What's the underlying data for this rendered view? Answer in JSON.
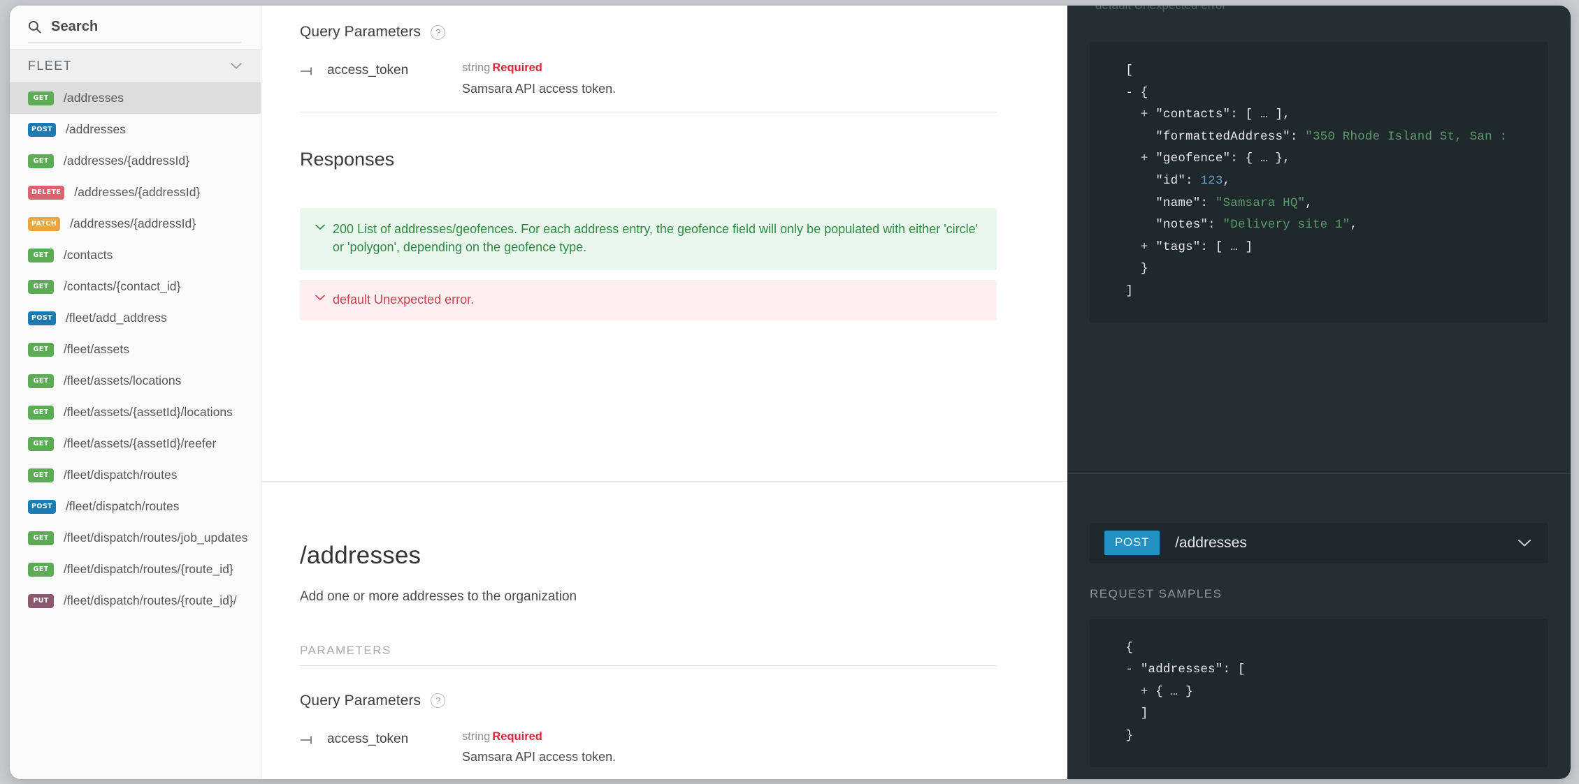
{
  "sidebar": {
    "search": {
      "placeholder": "Search",
      "icon": "search-icon"
    },
    "group": {
      "label": "FLEET",
      "icon": "chevron-down-icon"
    },
    "items": [
      {
        "method": "GET",
        "path": "/addresses",
        "active": true
      },
      {
        "method": "POST",
        "path": "/addresses",
        "active": false
      },
      {
        "method": "GET",
        "path": "/addresses/{addressId}",
        "active": false
      },
      {
        "method": "DELETE",
        "path": "/addresses/{addressId}",
        "active": false
      },
      {
        "method": "PATCH",
        "path": "/addresses/{addressId}",
        "active": false
      },
      {
        "method": "GET",
        "path": "/contacts",
        "active": false
      },
      {
        "method": "GET",
        "path": "/contacts/{contact_id}",
        "active": false
      },
      {
        "method": "POST",
        "path": "/fleet/add_address",
        "active": false
      },
      {
        "method": "GET",
        "path": "/fleet/assets",
        "active": false
      },
      {
        "method": "GET",
        "path": "/fleet/assets/locations",
        "active": false
      },
      {
        "method": "GET",
        "path": "/fleet/assets/{assetId}/locations",
        "active": false
      },
      {
        "method": "GET",
        "path": "/fleet/assets/{assetId}/reefer",
        "active": false
      },
      {
        "method": "GET",
        "path": "/fleet/dispatch/routes",
        "active": false
      },
      {
        "method": "POST",
        "path": "/fleet/dispatch/routes",
        "active": false
      },
      {
        "method": "GET",
        "path": "/fleet/dispatch/routes/job_updates",
        "active": false
      },
      {
        "method": "GET",
        "path": "/fleet/dispatch/routes/{route_id}",
        "active": false
      },
      {
        "method": "PUT",
        "path": "/fleet/dispatch/routes/{route_id}/",
        "active": false
      }
    ]
  },
  "top_section": {
    "query_parameters_title": "Query Parameters",
    "help_icon_glyph": "?",
    "param": {
      "name": "access_token",
      "type": "string",
      "required_label": "Required",
      "description": "Samsara API access token."
    },
    "responses_title": "Responses",
    "responses": [
      {
        "status": "200",
        "text": "200 List of addresses/geofences. For each address entry, the geofence field will only be populated with either 'circle' or 'polygon', depending on the geofence type.",
        "tone": "ok"
      },
      {
        "status": "default",
        "text": "default Unexpected error.",
        "tone": "error"
      }
    ]
  },
  "bottom_section": {
    "endpoint_title": "/addresses",
    "endpoint_description": "Add one or more addresses to the organization",
    "parameters_label": "PARAMETERS",
    "query_parameters_title": "Query Parameters",
    "help_icon_glyph": "?",
    "param": {
      "name": "access_token",
      "type": "string",
      "required_label": "Required",
      "description": "Samsara API access token."
    }
  },
  "right_panel": {
    "cut_off_text": "default Unexpected error",
    "response_sample_lines": [
      {
        "indent": 0,
        "prefix": "",
        "text": "["
      },
      {
        "indent": 1,
        "prefix": "-",
        "text": "{"
      },
      {
        "indent": 2,
        "prefix": "+",
        "text": "\"contacts\": [ … ],"
      },
      {
        "indent": 2,
        "prefix": "",
        "text": "\"formattedAddress\": ",
        "value": "\"350 Rhode Island St, San :",
        "valueType": "string"
      },
      {
        "indent": 2,
        "prefix": "+",
        "text": "\"geofence\": { … },"
      },
      {
        "indent": 2,
        "prefix": "",
        "text": "\"id\": ",
        "value": "123",
        "valueType": "number",
        "suffix": ","
      },
      {
        "indent": 2,
        "prefix": "",
        "text": "\"name\": ",
        "value": "\"Samsara HQ\"",
        "valueType": "string",
        "suffix": ","
      },
      {
        "indent": 2,
        "prefix": "",
        "text": "\"notes\": ",
        "value": "\"Delivery site 1\"",
        "valueType": "string",
        "suffix": ","
      },
      {
        "indent": 2,
        "prefix": "+",
        "text": "\"tags\": [ … ]"
      },
      {
        "indent": 1,
        "prefix": "",
        "text": "}"
      },
      {
        "indent": 0,
        "prefix": "",
        "text": "]"
      }
    ],
    "method_bar": {
      "method": "POST",
      "path": "/addresses",
      "chevron_icon": "chevron-down-icon"
    },
    "request_samples_label": "REQUEST SAMPLES",
    "request_sample_lines": [
      {
        "indent": 0,
        "prefix": "",
        "text": "{"
      },
      {
        "indent": 1,
        "prefix": "-",
        "text": "\"addresses\": ["
      },
      {
        "indent": 2,
        "prefix": "+",
        "text": "{ … }"
      },
      {
        "indent": 1,
        "prefix": "",
        "text": "]"
      },
      {
        "indent": 0,
        "prefix": "",
        "text": "}"
      }
    ]
  },
  "colors": {
    "get": "#5dab56",
    "post": "#1c7ab0",
    "delete": "#d8636f",
    "patch": "#e8a63e",
    "put": "#8a5a6e",
    "required": "#e0263d",
    "response_ok": "#2f8b44",
    "response_error": "#cf4050",
    "panel_bg": "#242e33",
    "code_bg": "#1f282d",
    "accent": "#2491c4"
  }
}
